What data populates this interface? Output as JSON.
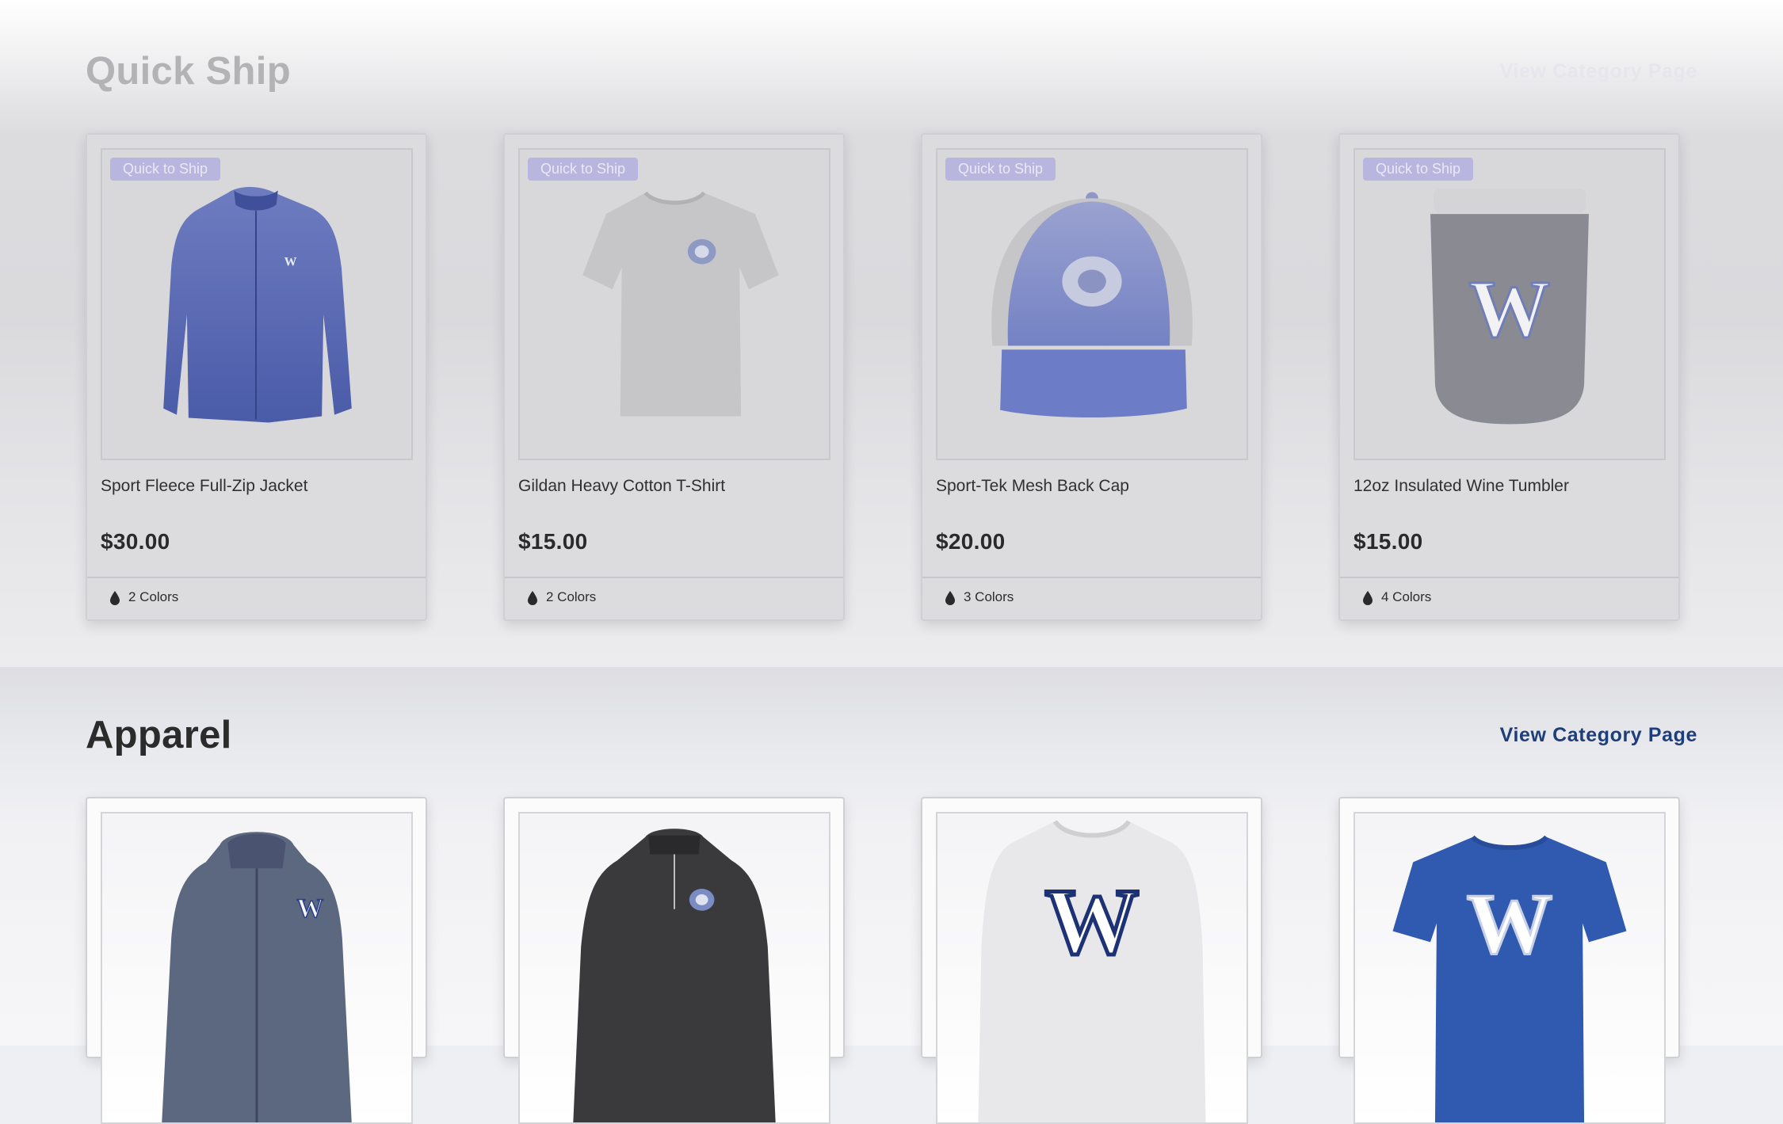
{
  "quick_ship": {
    "title": "Quick Ship",
    "link": "View Category Page",
    "products": [
      {
        "badge": "Quick to Ship",
        "name": "Sport Fleece Full-Zip Jacket",
        "price": "$30.00",
        "colors": "2 Colors",
        "icon": "jacket-image"
      },
      {
        "badge": "Quick to Ship",
        "name": "Gildan Heavy Cotton T-Shirt",
        "price": "$15.00",
        "colors": "2 Colors",
        "icon": "tshirt-image"
      },
      {
        "badge": "Quick to Ship",
        "name": "Sport-Tek Mesh Back Cap",
        "price": "$20.00",
        "colors": "3 Colors",
        "icon": "cap-image"
      },
      {
        "badge": "Quick to Ship",
        "name": "12oz Insulated Wine Tumbler",
        "price": "$15.00",
        "colors": "4 Colors",
        "icon": "tumbler-image"
      }
    ]
  },
  "apparel": {
    "title": "Apparel",
    "link": "View Category Page",
    "products": [
      {
        "icon": "rain-jacket-image"
      },
      {
        "icon": "quarter-zip-pullover-image"
      },
      {
        "icon": "long-sleeve-shirt-image"
      },
      {
        "icon": "royal-tshirt-image"
      }
    ]
  },
  "colors": {
    "link_active": "#1d3e7a",
    "link_faded": "#e6e6ec",
    "title_faded": "#b3b3b6",
    "title_active": "#2b2b2b",
    "badge": "#b8b6df",
    "brand_blue": "#2f5ab0",
    "product_blue": "#5a6fb8"
  }
}
